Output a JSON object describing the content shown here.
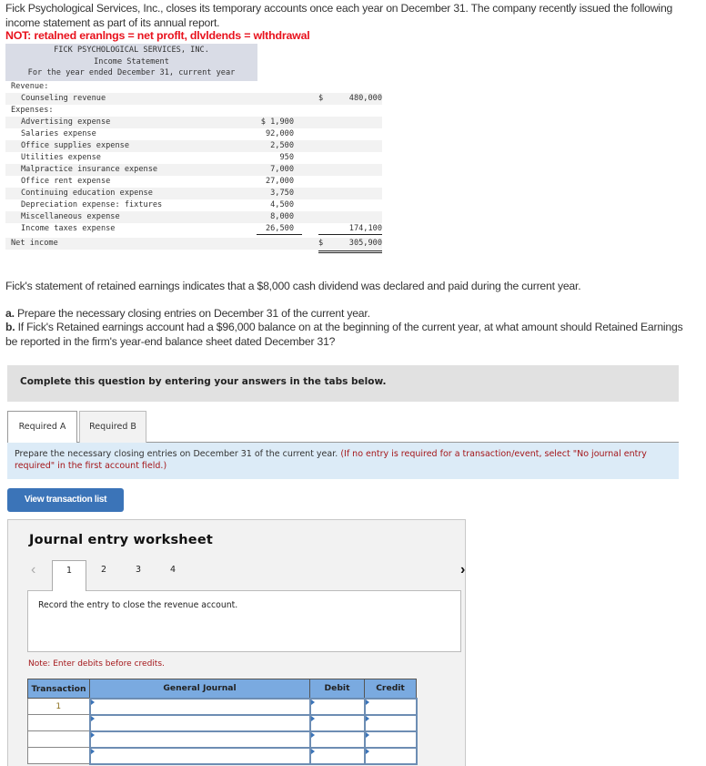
{
  "intro": {
    "paragraph": "Fick Psychological Services, Inc., closes its temporary accounts once each year on December 31. The company recently issued the following income statement as part of its annual report.",
    "red_note": "NOT: retalned eranlngs = net proflt, dlvldends = wlthdrawal",
    "red_note_color": "#e8121d"
  },
  "income_statement": {
    "company": "FICK PSYCHOLOGICAL SERVICES, INC.",
    "title": "Income Statement",
    "period": "For the year ended December 31, current year",
    "revenue_label": "Revenue:",
    "revenue_items": [
      {
        "label": "Counseling revenue",
        "currency": "$",
        "amount": "480,000"
      }
    ],
    "expenses_label": "Expenses:",
    "expense_items": [
      {
        "label": "Advertising expense",
        "amount": "$ 1,900"
      },
      {
        "label": "Salaries expense",
        "amount": "92,000"
      },
      {
        "label": "Office supplies expense",
        "amount": "2,500"
      },
      {
        "label": "Utilities expense",
        "amount": "950"
      },
      {
        "label": "Malpractice insurance expense",
        "amount": "7,000"
      },
      {
        "label": "Office rent expense",
        "amount": "27,000"
      },
      {
        "label": "Continuing education expense",
        "amount": "3,750"
      },
      {
        "label": "Depreciation expense: fixtures",
        "amount": "4,500"
      },
      {
        "label": "Miscellaneous expense",
        "amount": "8,000"
      },
      {
        "label": "Income taxes expense",
        "amount": "26,500"
      }
    ],
    "total_expenses": "174,100",
    "net_income_label": "Net income",
    "net_income_currency": "$",
    "net_income": "305,900"
  },
  "question": {
    "dividend_text": "Fick's statement of retained earnings indicates that a $8,000 cash dividend was declared and paid during the current year.",
    "part_a_prefix": "a.",
    "part_a": " Prepare the necessary closing entries on December 31 of the current year.",
    "part_b_prefix": "b.",
    "part_b": " If Fick's Retained earnings account had a $96,000 balance on at the beginning of the current year, at what amount should Retained Earnings be reported in the firm's year-end balance sheet dated December 31?"
  },
  "complete_bar": "Complete this question by entering your answers in the tabs below.",
  "tabs": [
    {
      "label": "Required A",
      "active": true
    },
    {
      "label": "Required B",
      "active": false
    }
  ],
  "instruction": {
    "main": "Prepare the necessary closing entries on December 31 of the current year.",
    "red": "(If no entry is required for a transaction/event, select \"No journal entry required\" in the first account field.)"
  },
  "view_button": "View transaction list",
  "worksheet": {
    "title": "Journal entry worksheet",
    "prev_icon": "‹",
    "next_icon": "›",
    "pages": [
      "1",
      "2",
      "3",
      "4"
    ],
    "active_page": "1",
    "prompt": "Record the entry to close the revenue account.",
    "note": "Note: Enter debits before credits.",
    "table": {
      "headers": [
        "Transaction",
        "General Journal",
        "Debit",
        "Credit"
      ],
      "rows": [
        {
          "transaction": "1",
          "account": "",
          "debit": "",
          "credit": ""
        },
        {
          "transaction": "",
          "account": "",
          "debit": "",
          "credit": ""
        },
        {
          "transaction": "",
          "account": "",
          "debit": "",
          "credit": ""
        },
        {
          "transaction": "",
          "account": "",
          "debit": "",
          "credit": ""
        }
      ]
    }
  }
}
